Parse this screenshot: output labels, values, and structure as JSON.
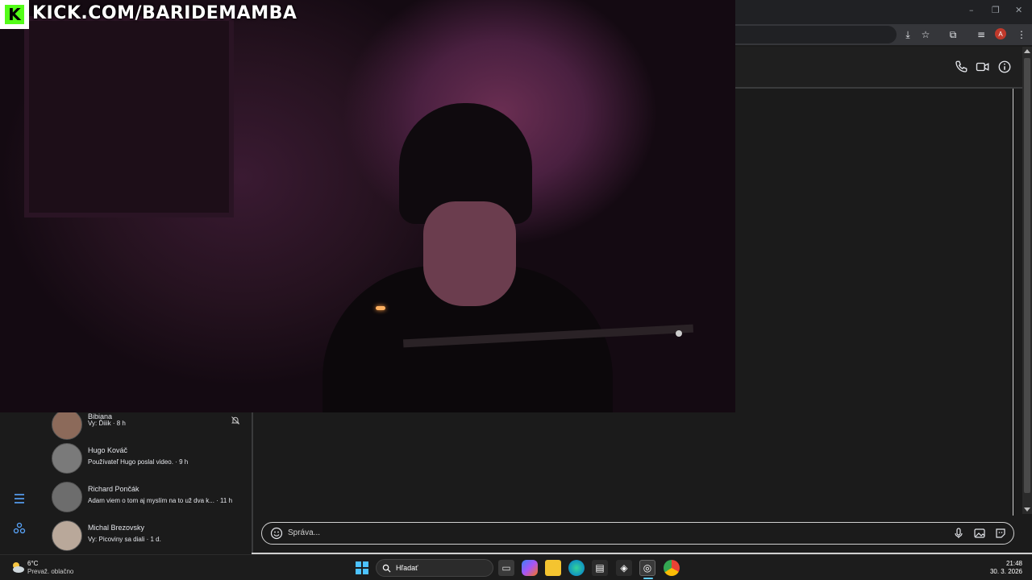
{
  "stream": {
    "badge_letter": "K",
    "url": "KICK.COM/BARIDEMAMBA"
  },
  "browser": {
    "minimize": "–",
    "restore": "❐",
    "close": "✕",
    "profile_initial": "A"
  },
  "conversations": [
    {
      "name": "Bibiana",
      "preview": "Vy: Ďiiik · 8 h",
      "avatar_color": "#8c6a5a"
    },
    {
      "name": "Hugo Kováč",
      "preview": "Používateľ Hugo poslal video. · 9 h",
      "avatar_color": "#7a7a7a"
    },
    {
      "name": "Richard Pončák",
      "preview": "Adam viem o tom aj myslím na to už dva k... · 11 h",
      "avatar_color": "#6d6d6d"
    },
    {
      "name": "Michal Brezovsky",
      "preview": "Vy: Picoviny sa diali · 1 d.",
      "avatar_color": "#b9a89a"
    }
  ],
  "composer": {
    "placeholder": "Správa..."
  },
  "taskbar": {
    "weather_temp": "6°C",
    "weather_desc": "Prevaž. oblačno",
    "search_label": "Hľadať",
    "time": "21:48",
    "date": "30. 3. 2026"
  },
  "colors": {
    "kick_green": "#53fc18",
    "messenger_blue": "#5aa7ff"
  }
}
